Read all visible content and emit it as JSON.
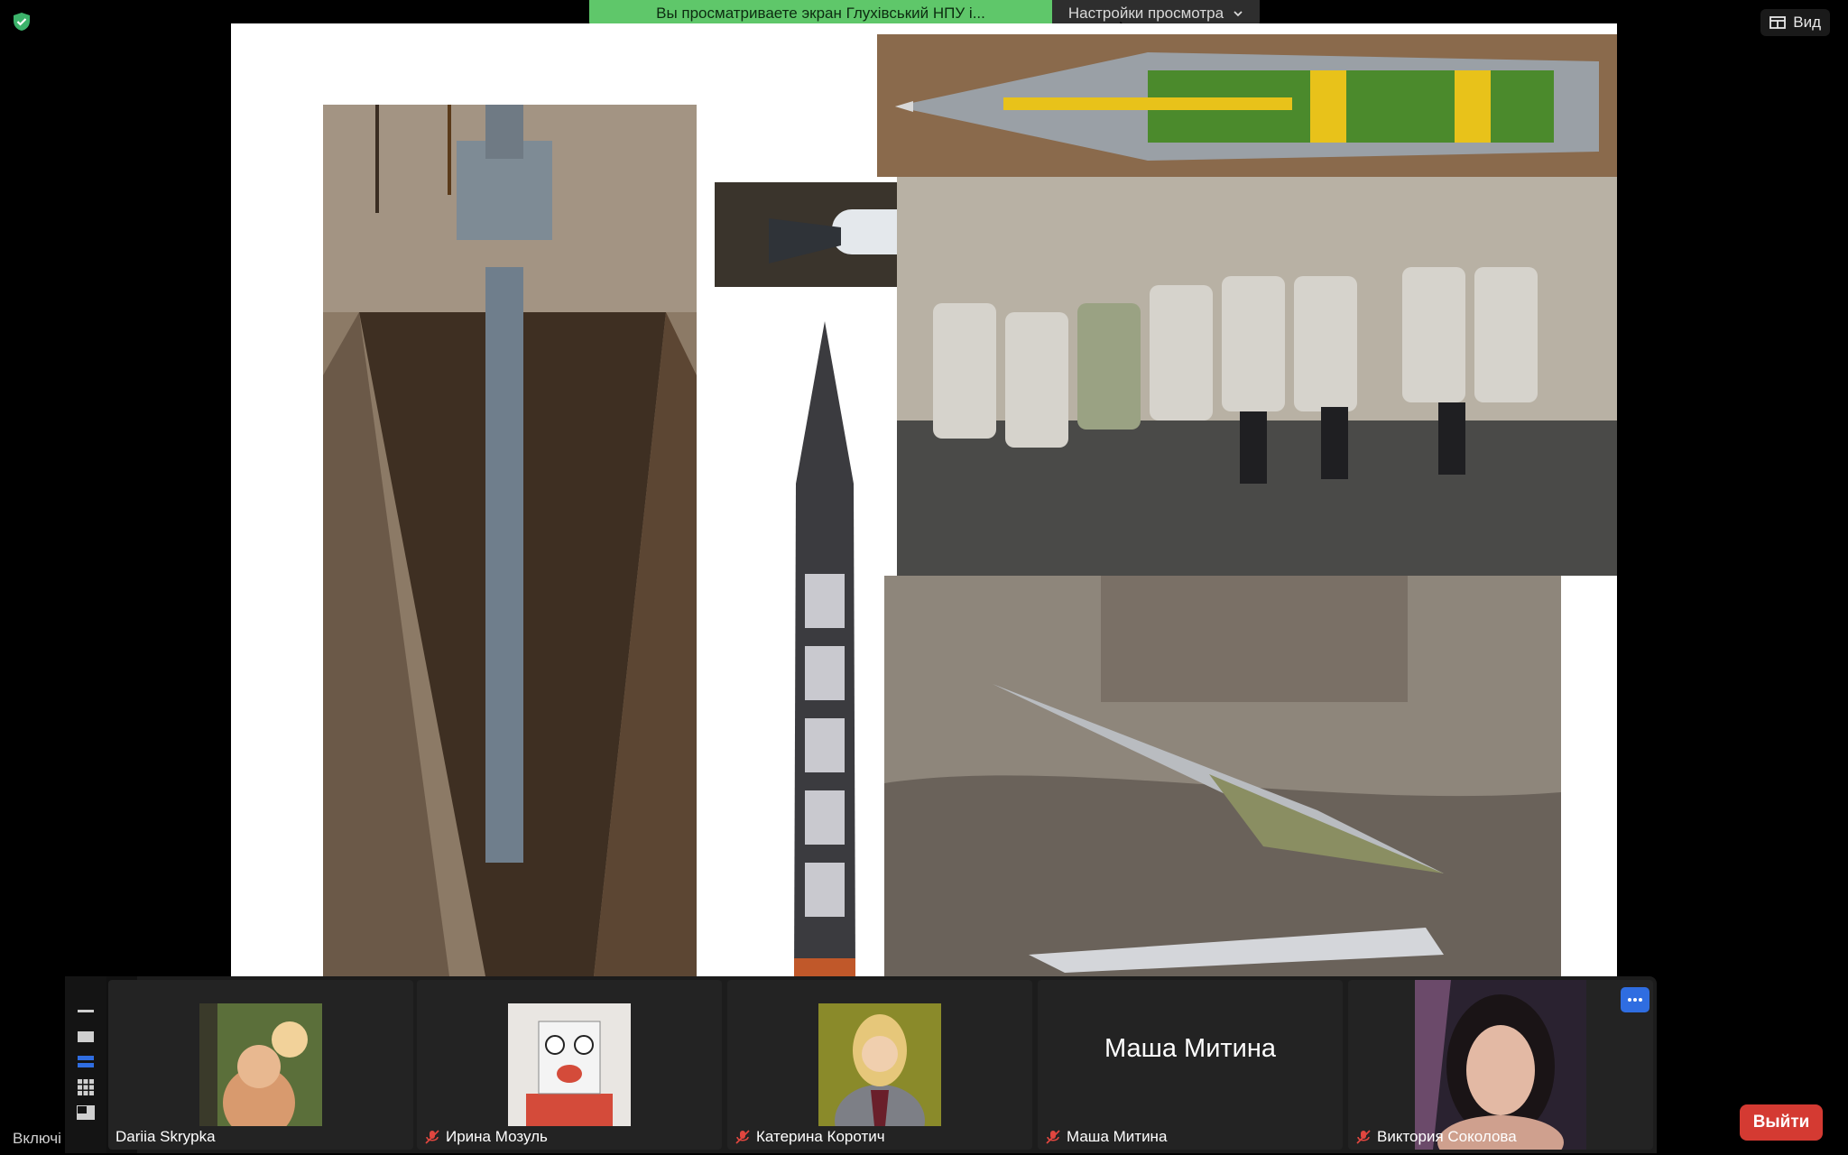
{
  "banner": {
    "sharing_text": "Вы просматриваете экран Глухівський НПУ і...",
    "view_options_label": "Настройки просмотра"
  },
  "view_button": {
    "label": "Вид"
  },
  "participants": [
    {
      "name": "Dariia Skrypka",
      "muted": true
    },
    {
      "name": "Ирина Мозуль",
      "muted": true
    },
    {
      "name": "Катерина Коротич",
      "muted": true
    },
    {
      "name": "Маша Митина",
      "muted": true,
      "display_name": "Маша Митина"
    },
    {
      "name": "Виктория Соколова",
      "muted": true
    }
  ],
  "toolbar": {
    "partial_label": "Включі",
    "leave_label": "Выйти"
  },
  "colors": {
    "banner_green": "#5fc76a",
    "leave_red": "#d43a32",
    "more_blue": "#2f6de1"
  }
}
